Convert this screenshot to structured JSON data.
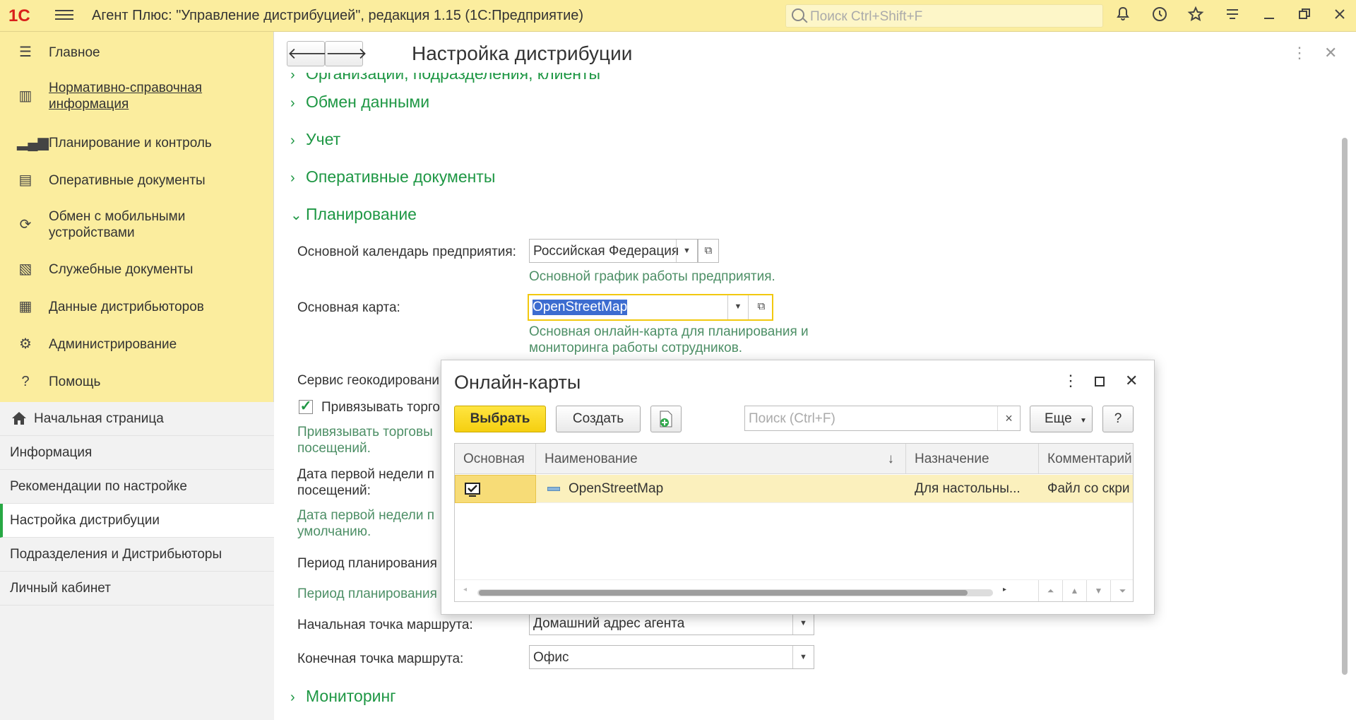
{
  "titlebar": {
    "logo": "1С",
    "title": "Агент Плюс: \"Управление дистрибуцией\", редакция 1.15  (1С:Предприятие)",
    "search_placeholder": "Поиск Ctrl+Shift+F"
  },
  "sidebar": {
    "items": [
      {
        "label": "Главное"
      },
      {
        "label": "Нормативно-справочная информация"
      },
      {
        "label": "Планирование и контроль"
      },
      {
        "label": "Оперативные документы"
      },
      {
        "label": "Обмен с мобильными устройствами"
      },
      {
        "label": "Служебные документы"
      },
      {
        "label": "Данные дистрибьюторов"
      },
      {
        "label": "Администрирование"
      },
      {
        "label": "Помощь"
      }
    ],
    "open_pages": [
      {
        "label": "Начальная страница"
      },
      {
        "label": "Информация"
      },
      {
        "label": "Рекомендации по настройке"
      },
      {
        "label": "Настройка дистрибуции"
      },
      {
        "label": "Подразделения и Дистрибьюторы"
      },
      {
        "label": "Личный кабинет"
      }
    ]
  },
  "main": {
    "title": "Настройка дистрибуции",
    "sections": {
      "org": "Организации, подразделения, клиенты",
      "exchange": "Обмен данными",
      "accounting": "Учет",
      "operational": "Оперативные документы",
      "planning": "Планирование",
      "monitoring": "Мониторинг"
    },
    "fields": {
      "calendar_label": "Основной календарь предприятия:",
      "calendar_value": "Российская Федерация",
      "calendar_hint": "Основной график работы предприятия.",
      "map_label": "Основная карта:",
      "map_value": "OpenStreetMap",
      "map_hint": "Основная онлайн-карта для планирования и мониторинга работы сотрудников.",
      "geocoding_label": "Сервис геокодировани",
      "bind_checkbox_label": "Привязывать торго",
      "bind_hint_1": "Привязывать торговы",
      "bind_hint_2": "посещений.",
      "firstweek_label_1": "Дата первой недели п",
      "firstweek_label_2": "посещений:",
      "firstweek_hint_1": "Дата первой недели п",
      "firstweek_hint_2": "умолчанию.",
      "period_label": "Период планирования",
      "period_hint": "Период планирования",
      "start_label": "Начальная точка маршрута:",
      "start_value": "Домашний адрес агента",
      "end_label": "Конечная точка маршрута:",
      "end_value": "Офис"
    }
  },
  "dialog": {
    "title": "Онлайн-карты",
    "select_button": "Выбрать",
    "create_button": "Создать",
    "search_placeholder": "Поиск (Ctrl+F)",
    "more_button": "Еще",
    "help_button": "?",
    "columns": [
      "Основная",
      "Наименование",
      "Назначение",
      "Комментарий"
    ],
    "rows": [
      {
        "name": "OpenStreetMap",
        "purpose": "Для настольны...",
        "comment": "Файл со скри"
      }
    ]
  },
  "colors": {
    "accent_yellow": "#fbed9e",
    "section_green": "#1e9744",
    "primary_button": "#f5cf10"
  }
}
